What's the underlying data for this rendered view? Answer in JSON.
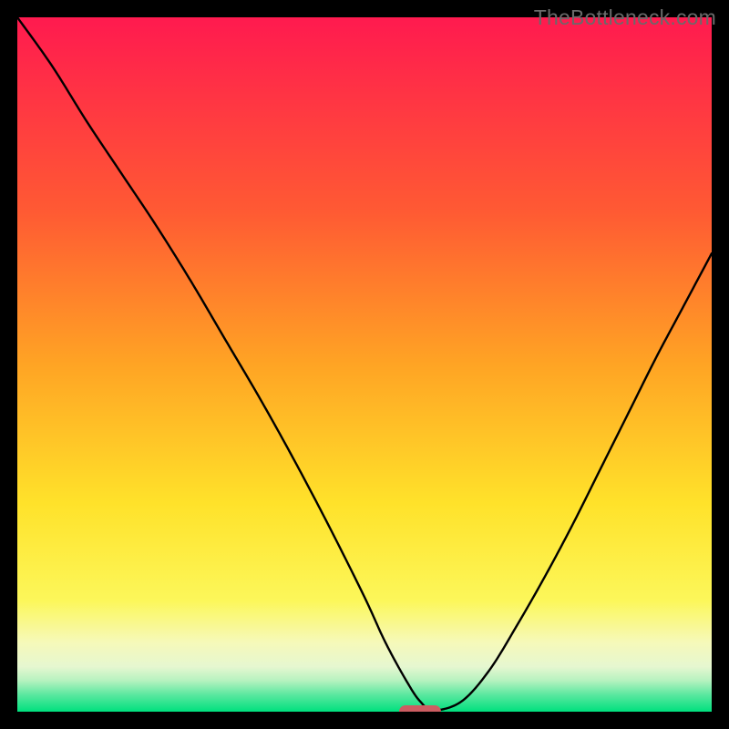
{
  "watermark": "TheBottleneck.com",
  "chart_data": {
    "type": "line",
    "title": "",
    "xlabel": "",
    "ylabel": "",
    "xlim": [
      0,
      100
    ],
    "ylim": [
      0,
      100
    ],
    "grid": false,
    "legend": false,
    "gradient_stops": [
      {
        "offset": 0,
        "color": "#ff1a4f"
      },
      {
        "offset": 0.28,
        "color": "#ff5a33"
      },
      {
        "offset": 0.5,
        "color": "#ffa424"
      },
      {
        "offset": 0.7,
        "color": "#ffe22a"
      },
      {
        "offset": 0.84,
        "color": "#fcf75a"
      },
      {
        "offset": 0.9,
        "color": "#f6f9b9"
      },
      {
        "offset": 0.935,
        "color": "#e6f7d0"
      },
      {
        "offset": 0.955,
        "color": "#b7f2c0"
      },
      {
        "offset": 0.975,
        "color": "#5de8a0"
      },
      {
        "offset": 1.0,
        "color": "#00e07e"
      }
    ],
    "series": [
      {
        "name": "bottleneck-curve",
        "x": [
          0,
          5,
          10,
          15,
          20,
          25,
          30,
          35,
          40,
          45,
          50,
          53,
          56,
          58,
          60,
          64,
          68,
          72,
          76,
          80,
          84,
          88,
          92,
          96,
          100
        ],
        "y": [
          100,
          93,
          85,
          77.5,
          70,
          62,
          53.5,
          45,
          36,
          26.5,
          16.5,
          10,
          4.5,
          1.5,
          0.2,
          1.5,
          6,
          12.5,
          19.5,
          27,
          35,
          43,
          51,
          58.5,
          66
        ]
      }
    ],
    "optimal_marker": {
      "x": 58,
      "y": 0
    },
    "curve_stroke": "#000000",
    "curve_width": 2.4
  }
}
